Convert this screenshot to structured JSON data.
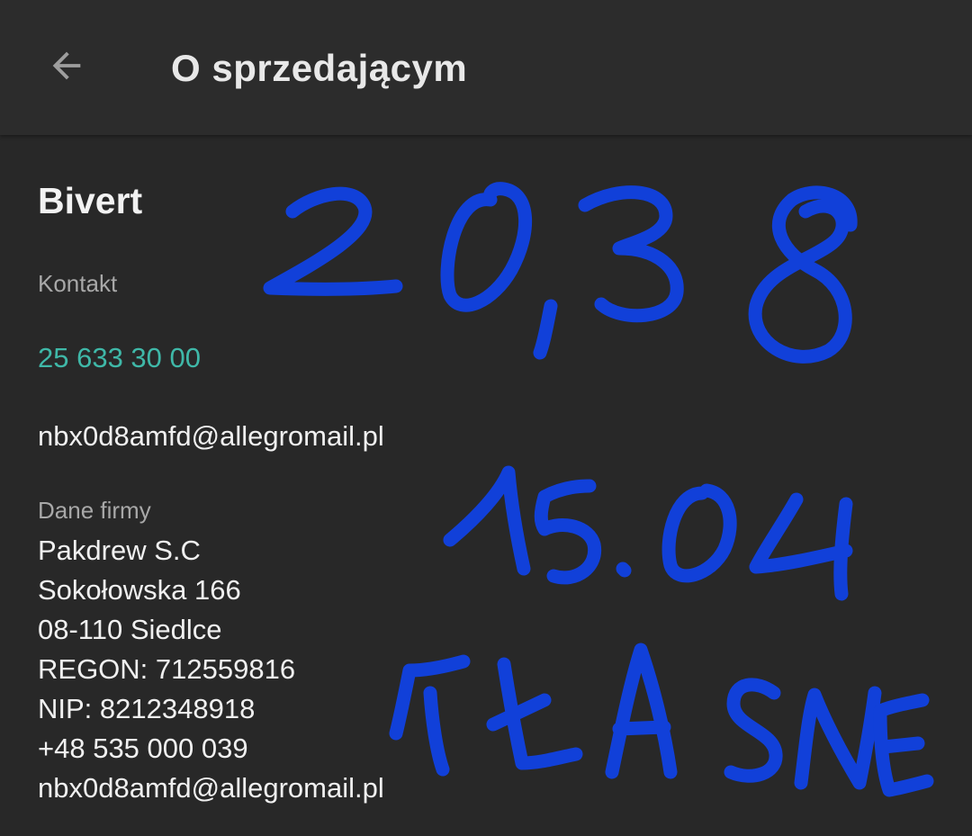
{
  "header": {
    "title": "O sprzedającym",
    "back_icon": "arrow-left-icon"
  },
  "seller": {
    "name": "Bivert"
  },
  "contact": {
    "label": "Kontakt",
    "phone": "25 633 30 00",
    "email": "nbx0d8amfd@allegromail.pl"
  },
  "company": {
    "label": "Dane firmy",
    "lines": [
      "Pakdrew S.C",
      "Sokołowska 166",
      "08-110 Siedlce",
      "REGON: 712559816",
      "NIP: 8212348918",
      "+48 535 000 039",
      "nbx0d8amfd@allegromail.pl"
    ]
  },
  "annotation": {
    "lines": [
      "20,38",
      "15.04",
      "WŁASNE"
    ],
    "color": "#1140d9"
  },
  "colors": {
    "background": "#282828",
    "appbar": "#2c2c2c",
    "link": "#3fb8a8",
    "text": "#f0f0f0",
    "muted": "#a8a8a8"
  }
}
